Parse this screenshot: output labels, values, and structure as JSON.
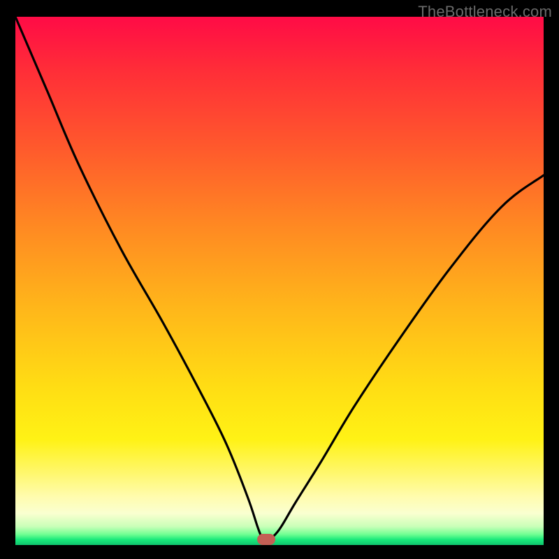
{
  "watermark": "TheBottleneck.com",
  "colors": {
    "frame_bg": "#000000",
    "curve": "#000000",
    "marker": "#c45f55",
    "watermark_text": "#6a6a6a"
  },
  "chart_data": {
    "type": "line",
    "title": "",
    "xlabel": "",
    "ylabel": "",
    "xlim": [
      0,
      100
    ],
    "ylim": [
      0,
      100
    ],
    "note": "Bottleneck-style V-curve over red-to-green vertical gradient; minimum near x≈47.",
    "x": [
      0,
      6,
      12,
      20,
      28,
      35,
      40,
      44,
      46,
      47,
      48,
      50,
      53,
      58,
      64,
      72,
      82,
      92,
      100
    ],
    "values": [
      100,
      86,
      72,
      56,
      42,
      29,
      19,
      9,
      3,
      1,
      1,
      3,
      8,
      16,
      26,
      38,
      52,
      64,
      70
    ],
    "marker": {
      "x": 47.5,
      "y": 1
    },
    "gradient_stops": [
      {
        "pos": 0,
        "color": "#ff0b46"
      },
      {
        "pos": 0.4,
        "color": "#ff8a22"
      },
      {
        "pos": 0.7,
        "color": "#ffdd14"
      },
      {
        "pos": 0.91,
        "color": "#fffcb0"
      },
      {
        "pos": 0.98,
        "color": "#6fff92"
      },
      {
        "pos": 1.0,
        "color": "#10c46e"
      }
    ]
  }
}
